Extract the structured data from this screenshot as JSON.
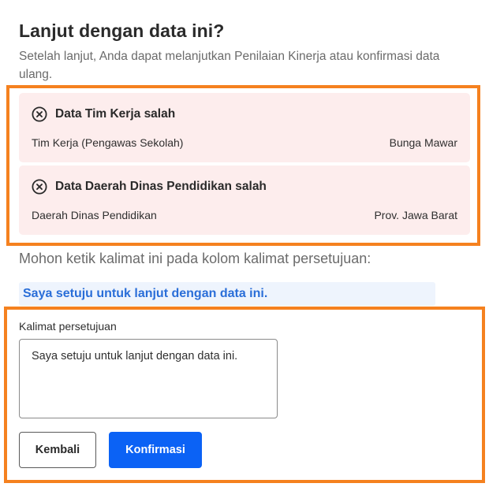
{
  "dialog": {
    "title": "Lanjut dengan data ini?",
    "subtitle": "Setelah lanjut, Anda dapat melanjutkan Penilaian Kinerja atau konfirmasi data ulang."
  },
  "errors": [
    {
      "icon": "x-circle-icon",
      "title": "Data Tim Kerja salah",
      "label": "Tim Kerja (Pengawas Sekolah)",
      "value": "Bunga Mawar"
    },
    {
      "icon": "x-circle-icon",
      "title": "Data Daerah Dinas Pendidikan salah",
      "label": "Daerah Dinas Pendidikan",
      "value": "Prov. Jawa Barat"
    }
  ],
  "agreement": {
    "instruction": "Mohon ketik kalimat ini pada kolom kalimat persetujuan:",
    "phrase": "Saya setuju untuk lanjut dengan data ini.",
    "field_label": "Kalimat persetujuan",
    "field_value": "Saya setuju untuk lanjut dengan data ini."
  },
  "actions": {
    "back_label": "Kembali",
    "confirm_label": "Konfirmasi"
  },
  "colors": {
    "highlight": "#f5811f",
    "error_bg": "#fdeded",
    "phrase_bg": "#eef4fd",
    "phrase_text": "#2a6ed8",
    "primary": "#0b62f5"
  }
}
